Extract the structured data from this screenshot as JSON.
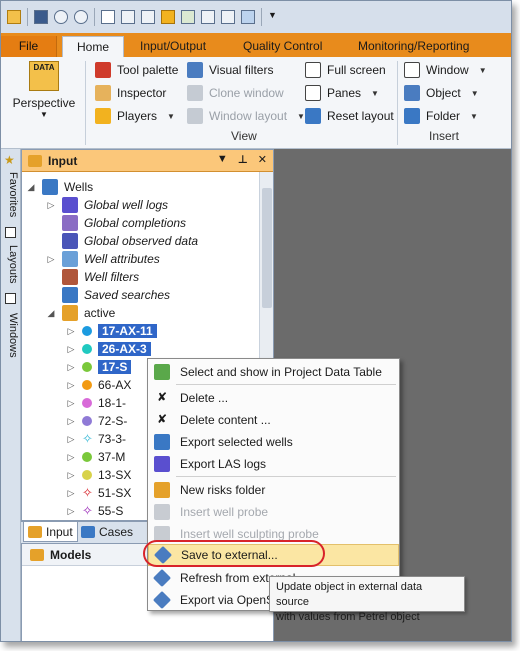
{
  "tabs": {
    "file": "File",
    "home": "Home",
    "input_output": "Input/Output",
    "quality_control": "Quality Control",
    "monitoring": "Monitoring/Reporting"
  },
  "ribbon": {
    "perspective": "Perspective",
    "tool_palette": "Tool palette",
    "visual_filters": "Visual filters",
    "full_screen": "Full screen",
    "inspector": "Inspector",
    "clone_window": "Clone window",
    "panes": "Panes",
    "players": "Players",
    "window_layout": "Window layout",
    "reset_layout": "Reset layout",
    "view_group": "View",
    "window": "Window",
    "object": "Object",
    "folder": "Folder",
    "insert_group": "Insert"
  },
  "side_tabs": {
    "favorites": "Favorites",
    "layouts": "Layouts",
    "windows": "Windows"
  },
  "input_panel": {
    "title": "Input",
    "tree": {
      "wells": "Wells",
      "global_well_logs": "Global well logs",
      "global_completions": "Global completions",
      "global_observed_data": "Global observed data",
      "well_attributes": "Well attributes",
      "well_filters": "Well filters",
      "saved_searches": "Saved searches",
      "active": "active",
      "wells_list": [
        "17-AX-11",
        "26-AX-3",
        "17-S",
        "66-AX",
        "18-1-",
        "72-S-",
        "73-3-",
        "37-M",
        "13-SX",
        "51-SX",
        "55-S"
      ]
    }
  },
  "bottom_tabs": {
    "input": "Input",
    "cases": "Cases"
  },
  "models_panel": {
    "title": "Models"
  },
  "context_menu": {
    "select_show": "Select and show in Project Data Table",
    "delete": "Delete ...",
    "delete_content": "Delete content ...",
    "export_selected": "Export selected wells",
    "export_las": "Export LAS logs",
    "new_risks": "New risks folder",
    "insert_probe": "Insert well probe",
    "insert_sculpting": "Insert well sculpting probe",
    "save_external": "Save to external...",
    "refresh_external": "Refresh from external",
    "export_opens": "Export via OpenS"
  },
  "tooltip": {
    "line1": "Update object in external data source",
    "line2": "with values from Petrel object"
  },
  "colors": {
    "tab_bar": "#e88b1c",
    "panel_header": "#fbc77a",
    "selection": "#2f66c8",
    "highlight_ring": "#d8232a",
    "menu_highlight": "#fbe6a3"
  }
}
